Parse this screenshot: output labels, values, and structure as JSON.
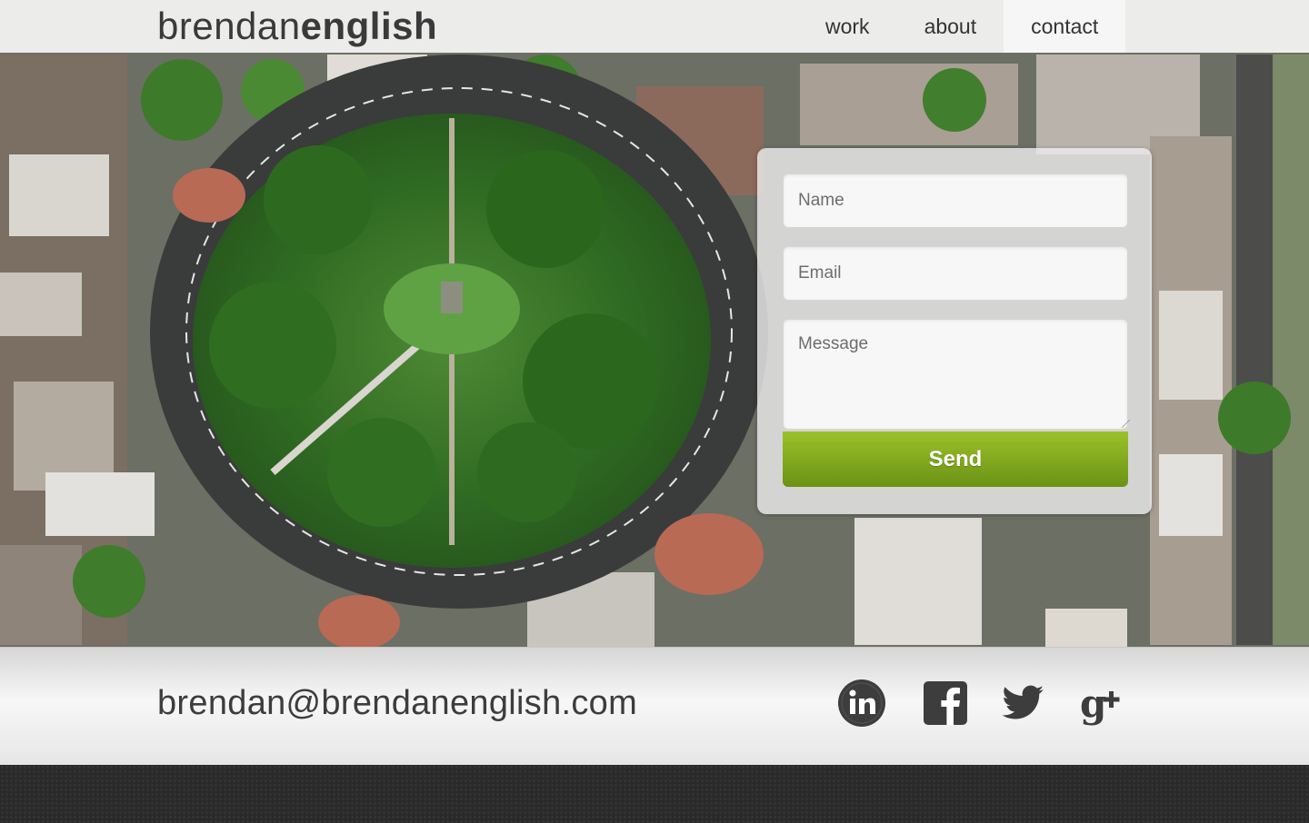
{
  "header": {
    "logo_first": "brendan",
    "logo_last": "english",
    "nav": [
      "work",
      "about",
      "contact"
    ],
    "active_nav": "contact"
  },
  "contact_form": {
    "name_placeholder": "Name",
    "email_placeholder": "Email",
    "message_placeholder": "Message",
    "send_label": "Send"
  },
  "footer": {
    "email": "brendan@brendanenglish.com",
    "social_icons": [
      "linkedin-icon",
      "facebook-icon",
      "twitter-icon",
      "google-plus-icon"
    ]
  },
  "colors": {
    "accent_green": "#8ab51f",
    "icon_gray": "#3d3d3d",
    "footer_dark": "#2a2a2a"
  }
}
